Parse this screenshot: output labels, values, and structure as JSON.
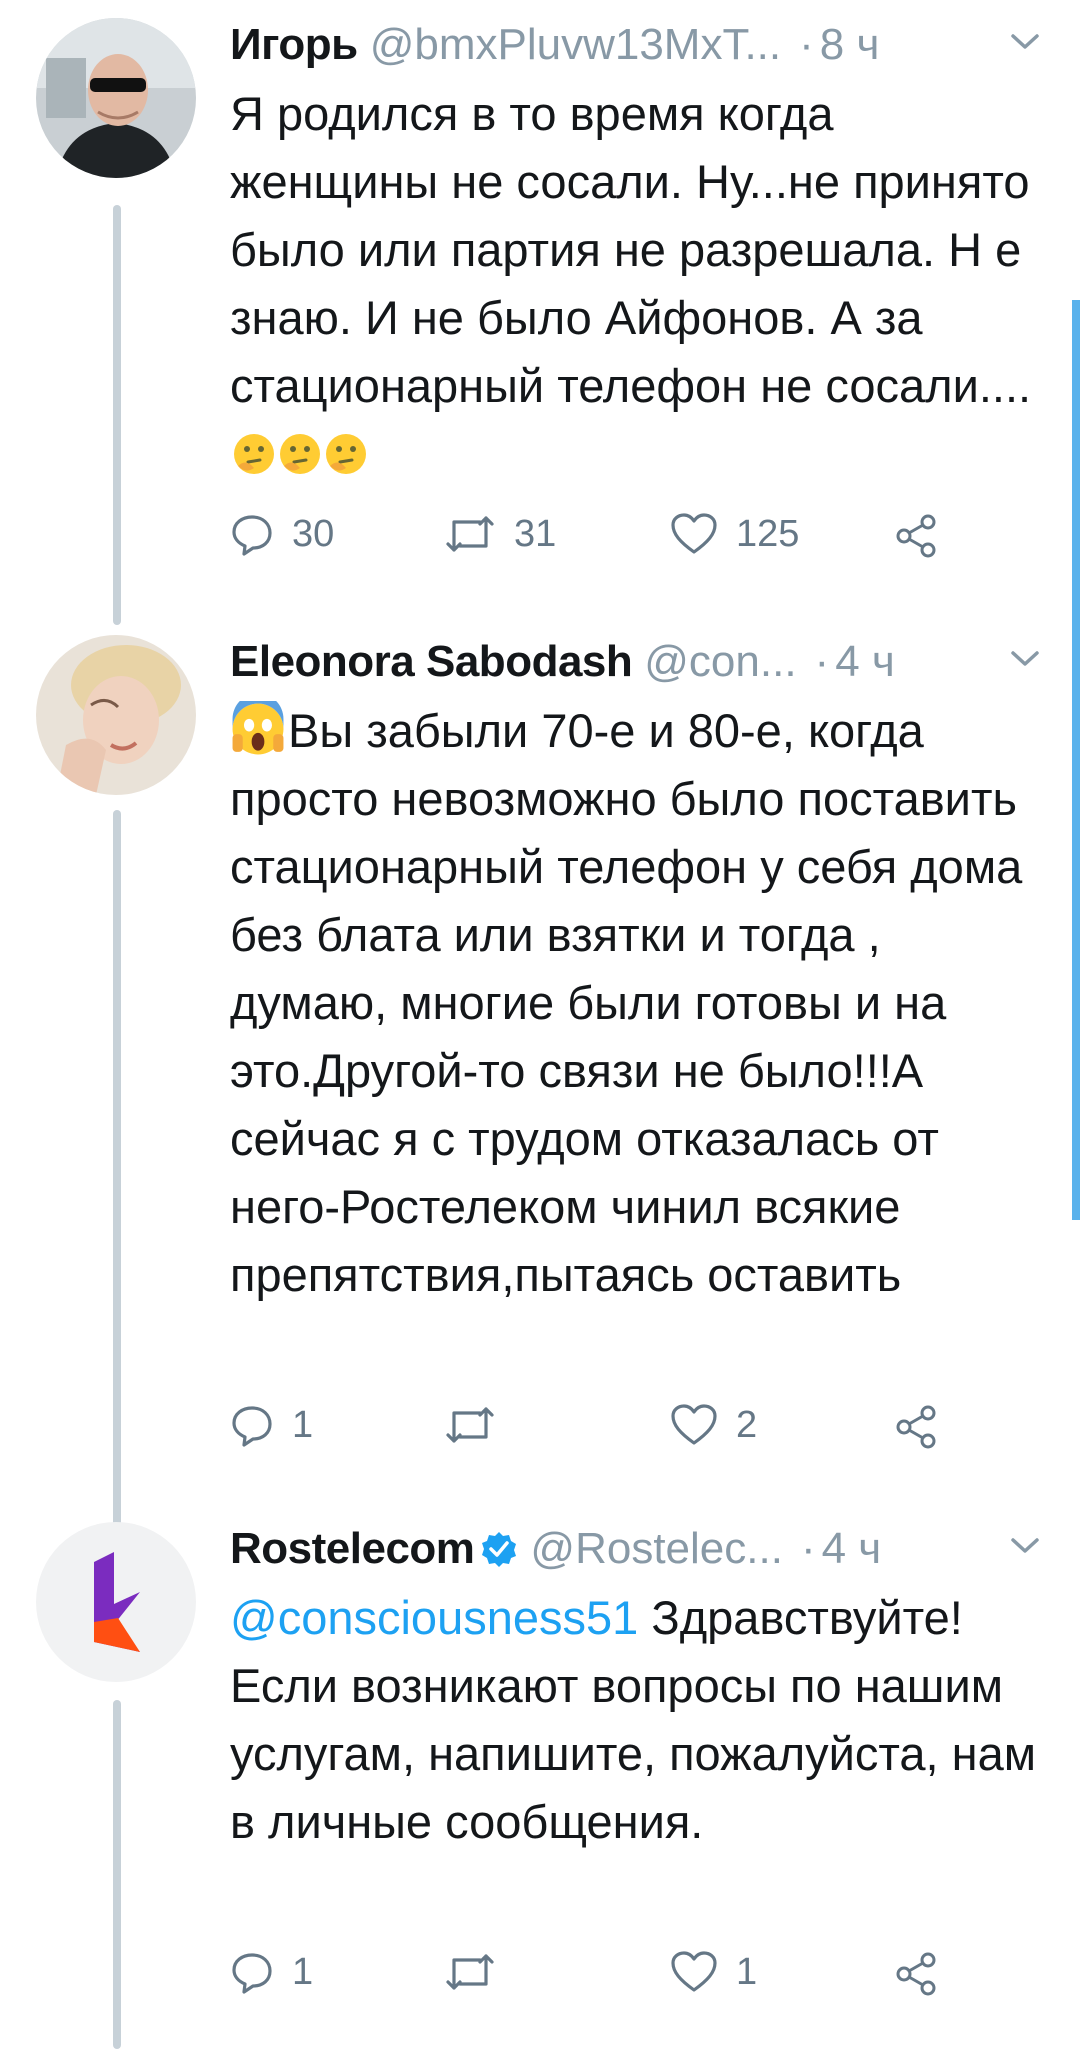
{
  "colors": {
    "link": "#1da1f2",
    "muted": "#8899a6",
    "text": "#14171a",
    "thread_line": "#c7d1d8",
    "rostelecom_brand": "#7b2cbf"
  },
  "tweets": [
    {
      "name": "Игорь",
      "handle": "@bmxPluvw13MxT...",
      "dot": "·",
      "time": "8 ч",
      "text": "Я родился в то время когда женщины не сосали. Ну...не принято было или партия не разрешала. Н е знаю. И не было Айфонов. А за стационарный телефон не сосали....",
      "emojis": [
        "thinking-face",
        "thinking-face",
        "thinking-face"
      ],
      "replies": "30",
      "retweets": "31",
      "likes": "125"
    },
    {
      "name": "Eleonora Sabodash",
      "handle": "@con...",
      "dot": "·",
      "time": "4 ч",
      "emoji_lead": "screaming-face",
      "text": "Вы забыли 70-е и 80-е, когда просто невозможно было поставить стационарный телефон у себя дома без блата или взятки и тогда , думаю, многие были готовы и на это.Другой-то связи не было!!!А сейчас я с трудом отказалась от него-Ростелеком чинил всякие препятствия,пытаясь оставить",
      "replies": "1",
      "retweets": "",
      "likes": "2"
    },
    {
      "name": "Rostelecom",
      "verified": true,
      "handle": "@Rostelec...",
      "dot": "·",
      "time": "4 ч",
      "mention": "@consciousness51",
      "text": "Здравствуйте! Если возникают вопросы по нашим услугам, напишите, пожалуйста, нам в личные сообщения.",
      "replies": "1",
      "retweets": "",
      "likes": "1"
    }
  ]
}
